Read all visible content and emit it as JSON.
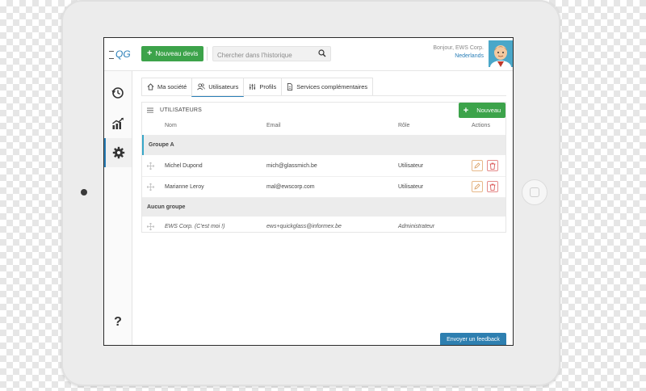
{
  "topbar": {
    "logo_text": "QG",
    "new_quote_label": "Nouveau devis",
    "search_placeholder": "Chercher dans l'historique",
    "greeting": "Bonjour, EWS Corp.",
    "location": "Nederlands"
  },
  "sidebar": {
    "items": [
      {
        "icon": "history-icon"
      },
      {
        "icon": "chart-icon"
      },
      {
        "icon": "gear-icon",
        "active": true
      }
    ],
    "help_label": "?"
  },
  "tabs": [
    {
      "label": "Ma société",
      "icon": "home-icon"
    },
    {
      "label": "Utilisateurs",
      "icon": "users-icon",
      "active": true
    },
    {
      "label": "Profils",
      "icon": "sliders-icon"
    },
    {
      "label": "Services complémentaires",
      "icon": "document-icon"
    }
  ],
  "panel": {
    "title": "UTILISATEURS",
    "add_label": "Nouveau",
    "columns": {
      "name": "Nom",
      "email": "Email",
      "role": "Rôle",
      "actions": "Actions"
    },
    "groups": [
      {
        "name": "Groupe A",
        "users": [
          {
            "name": "Michel Dupond",
            "email": "mich@glassmich.be",
            "role": "Utilisateur"
          },
          {
            "name": "Marianne Leroy",
            "email": "mal@ewscorp.com",
            "role": "Utilisateur"
          }
        ]
      },
      {
        "name": "Aucun groupe",
        "users": [
          {
            "name": "EWS Corp. (C'est moi !)",
            "email": "ews+quickglass@informex.be",
            "role": "Administrateur"
          }
        ]
      }
    ]
  },
  "feedback_label": "Envoyer un feedback",
  "colors": {
    "accent_blue": "#2a7fb8",
    "green": "#3ca34a",
    "edit_orange": "#e7b889",
    "delete_red": "#e48a8a"
  }
}
